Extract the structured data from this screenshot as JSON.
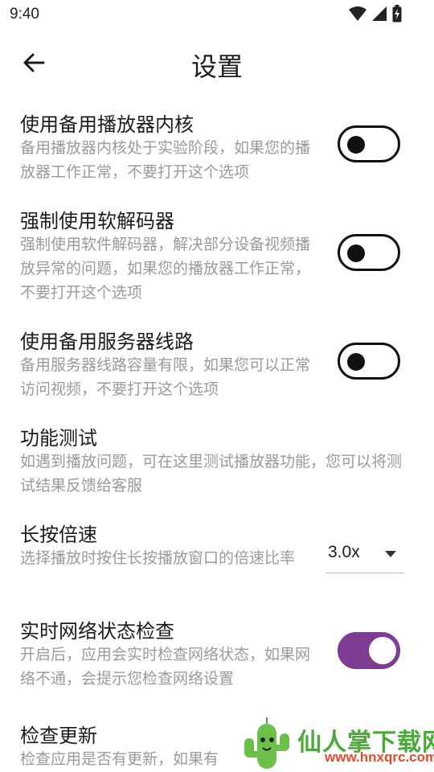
{
  "status_bar": {
    "time": "9:40",
    "icons": [
      "wifi-icon",
      "signal-icon",
      "battery-charging-icon"
    ]
  },
  "app_bar": {
    "title": "设置",
    "back_icon": "arrow-left-icon"
  },
  "settings": [
    {
      "title": "使用备用播放器内核",
      "description": "备用播放器内核处于实验阶段，如果您的播放器工作正常，不要打开这个选项",
      "control": "toggle",
      "enabled": false
    },
    {
      "title": "强制使用软解码器",
      "description": "强制使用软件解码器，解决部分设备视频播放异常的问题，如果您的播放器工作正常，不要打开这个选项",
      "control": "toggle",
      "enabled": false
    },
    {
      "title": "使用备用服务器线路",
      "description": "备用服务器线路容量有限，如果您可以正常访问视频，不要打开这个选项",
      "control": "toggle",
      "enabled": false
    },
    {
      "title": "功能测试",
      "description": "如遇到播放问题，可在这里测试播放器功能，您可以将测试结果反馈给客服",
      "control": "none"
    },
    {
      "title": "长按倍速",
      "description": "选择播放时按住长按播放窗口的倍速比率",
      "control": "dropdown",
      "value": "3.0x"
    },
    {
      "title": "实时网络状态检查",
      "description": "开启后，应用会实时检查网络状态，如果网络不通，会提示您检查网络设置",
      "control": "toggle",
      "enabled": true
    },
    {
      "title": "检查更新",
      "description": "检查应用是否有更新，如果有",
      "control": "none"
    }
  ],
  "watermark": {
    "text": "仙人掌下载网",
    "url": "www.hnxqrc.com"
  },
  "colors": {
    "accent": "#7e3d93",
    "text_primary": "#1b1b1b",
    "text_secondary": "#9a9a9a"
  }
}
